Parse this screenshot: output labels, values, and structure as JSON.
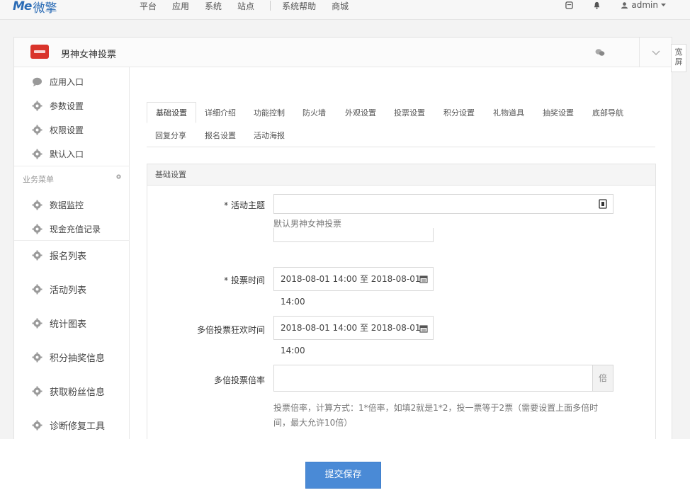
{
  "topbar": {
    "logo_mark": "Me",
    "logo_text": "微擎",
    "nav": [
      "平台",
      "应用",
      "系统",
      "站点",
      "系统帮助",
      "商城"
    ],
    "user": "admin"
  },
  "app": {
    "title": "男神女神投票",
    "wide_button": "宽屏"
  },
  "sidebar": {
    "top_items": [
      "应用入口",
      "参数设置",
      "权限设置",
      "默认入口"
    ],
    "section_title": "业务菜单",
    "menu_items": [
      "数据监控",
      "现金充值记录",
      "报名列表",
      "活动列表",
      "统计图表",
      "积分抽奖信息",
      "获取粉丝信息",
      "诊断修复工具"
    ]
  },
  "tabs": {
    "row1": [
      "基础设置",
      "详细介绍",
      "功能控制",
      "防火墙",
      "外观设置",
      "投票设置",
      "积分设置",
      "礼物道具",
      "抽奖设置",
      "底部导航"
    ],
    "row2": [
      "回复分享",
      "报名设置",
      "活动海报"
    ]
  },
  "form": {
    "section_title": "基础设置",
    "theme_label": "* 活动主题",
    "theme_value": "",
    "theme_hint": "默认男神女神投票",
    "vote_time_label": "* 投票时间",
    "vote_time_value": "2018-08-01 14:00 至 2018-08-01 14:00",
    "multi_time_label": "多倍投票狂欢时间",
    "multi_time_value": "2018-08-01 14:00 至 2018-08-01 14:00",
    "multi_rate_label": "多倍投票倍率",
    "multi_rate_value": "",
    "multi_rate_addon": "倍",
    "multi_rate_help": "投票倍率，计算方式：1*倍率，如填2就是1*2，投一票等于2票（需要设置上面多倍时间，最大允许10倍）"
  },
  "submit_label": "提交保存",
  "colors": {
    "brand": "#2a6bb5",
    "submit": "#4a8ad6",
    "app_logo": "#d9342b"
  }
}
